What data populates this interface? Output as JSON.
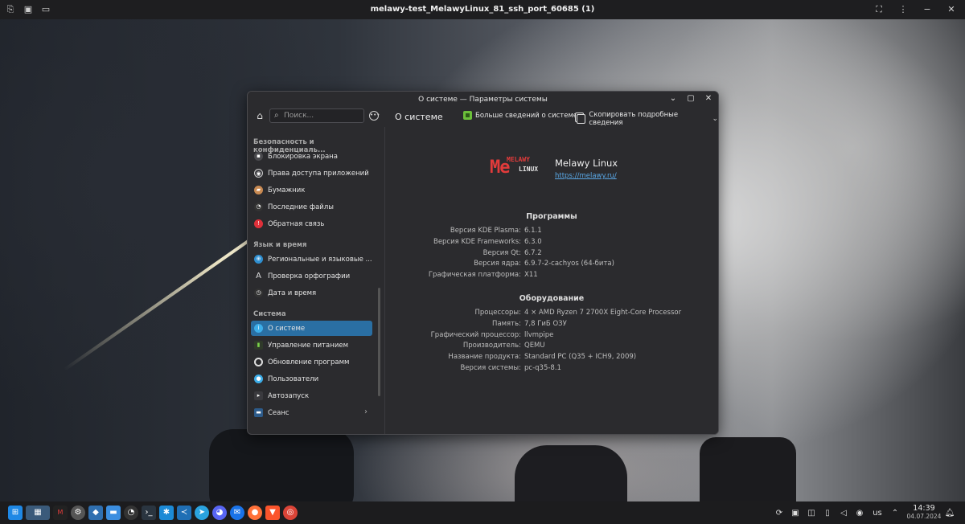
{
  "topbar": {
    "title": "melawy-test_MelawyLinux_81_ssh_port_60685 (1)",
    "left_icons": [
      "share-icon",
      "camera-icon",
      "monitor-icon"
    ],
    "right_controls": [
      "fullscreen-icon",
      "menu-dots-icon",
      "minimize-icon",
      "close-icon"
    ]
  },
  "window": {
    "title": "О системе — Параметры системы",
    "search_placeholder": "Поиск...",
    "page_title": "О системе",
    "more_info_label": "Больше сведений о системе",
    "copy_label": "Скопировать подробные сведения"
  },
  "sidebar": {
    "section1": "Безопасность и конфиденциаль...",
    "section1_items": [
      {
        "label": "Блокировка экрана",
        "icon": "lock-icon"
      },
      {
        "label": "Права доступа приложений",
        "icon": "permissions-icon"
      },
      {
        "label": "Бумажник",
        "icon": "wallet-icon"
      },
      {
        "label": "Последние файлы",
        "icon": "recent-files-icon"
      },
      {
        "label": "Обратная связь",
        "icon": "feedback-icon"
      }
    ],
    "section2": "Язык и время",
    "section2_items": [
      {
        "label": "Региональные и языковые ...",
        "icon": "region-icon"
      },
      {
        "label": "Проверка орфографии",
        "icon": "spellcheck-icon"
      },
      {
        "label": "Дата и время",
        "icon": "clock-icon"
      }
    ],
    "section3": "Система",
    "section3_items": [
      {
        "label": "О системе",
        "icon": "info-icon",
        "selected": true
      },
      {
        "label": "Управление питанием",
        "icon": "battery-icon"
      },
      {
        "label": "Обновление программ",
        "icon": "update-icon"
      },
      {
        "label": "Пользователи",
        "icon": "user-icon"
      },
      {
        "label": "Автозапуск",
        "icon": "autostart-icon"
      },
      {
        "label": "Сеанс",
        "icon": "session-icon"
      }
    ]
  },
  "about": {
    "logo_me": "Me",
    "logo_line1": "MELAWY",
    "logo_line2": "LINUX",
    "distro_name": "Melawy Linux",
    "distro_url": "https://melawy.ru/",
    "software_heading": "Программы",
    "software": [
      {
        "key": "Версия KDE Plasma:",
        "value": "6.1.1"
      },
      {
        "key": "Версия KDE Frameworks:",
        "value": "6.3.0"
      },
      {
        "key": "Версия Qt:",
        "value": "6.7.2"
      },
      {
        "key": "Версия ядра:",
        "value": "6.9.7-2-cachyos (64-бита)"
      },
      {
        "key": "Графическая платформа:",
        "value": "X11"
      }
    ],
    "hardware_heading": "Оборудование",
    "hardware": [
      {
        "key": "Процессоры:",
        "value": "4 × AMD Ryzen 7 2700X Eight-Core Processor"
      },
      {
        "key": "Память:",
        "value": "7,8 ГиБ ОЗУ"
      },
      {
        "key": "Графический процессор:",
        "value": "llvmpipe"
      },
      {
        "key": "Производитель:",
        "value": "QEMU"
      },
      {
        "key": "Название продукта:",
        "value": "Standard PC (Q35 + ICH9, 2009)"
      },
      {
        "key": "Версия системы:",
        "value": "pc-q35-8.1"
      }
    ]
  },
  "taskbar": {
    "apps": [
      "start-menu-icon",
      "virtual-desktops-icon",
      "melawy-app-icon",
      "system-settings-icon",
      "discover-store-icon",
      "file-manager-icon",
      "system-monitor-icon",
      "terminal-icon",
      "kde-connect-icon",
      "vscode-icon",
      "telegram-icon",
      "discord-icon",
      "thunderbird-icon",
      "firefox-icon",
      "brave-icon",
      "chrome-icon"
    ],
    "tray": [
      "updates-icon",
      "screenshot-icon",
      "store-tray-icon",
      "clipboard-icon",
      "volume-icon",
      "network-icon"
    ],
    "keyboard_layout": "us",
    "time": "14:39",
    "date": "04.07.2024"
  },
  "colors": {
    "accent": "#2a6fa3",
    "link": "#5aa8e6",
    "logo_red": "#e23b3b"
  }
}
